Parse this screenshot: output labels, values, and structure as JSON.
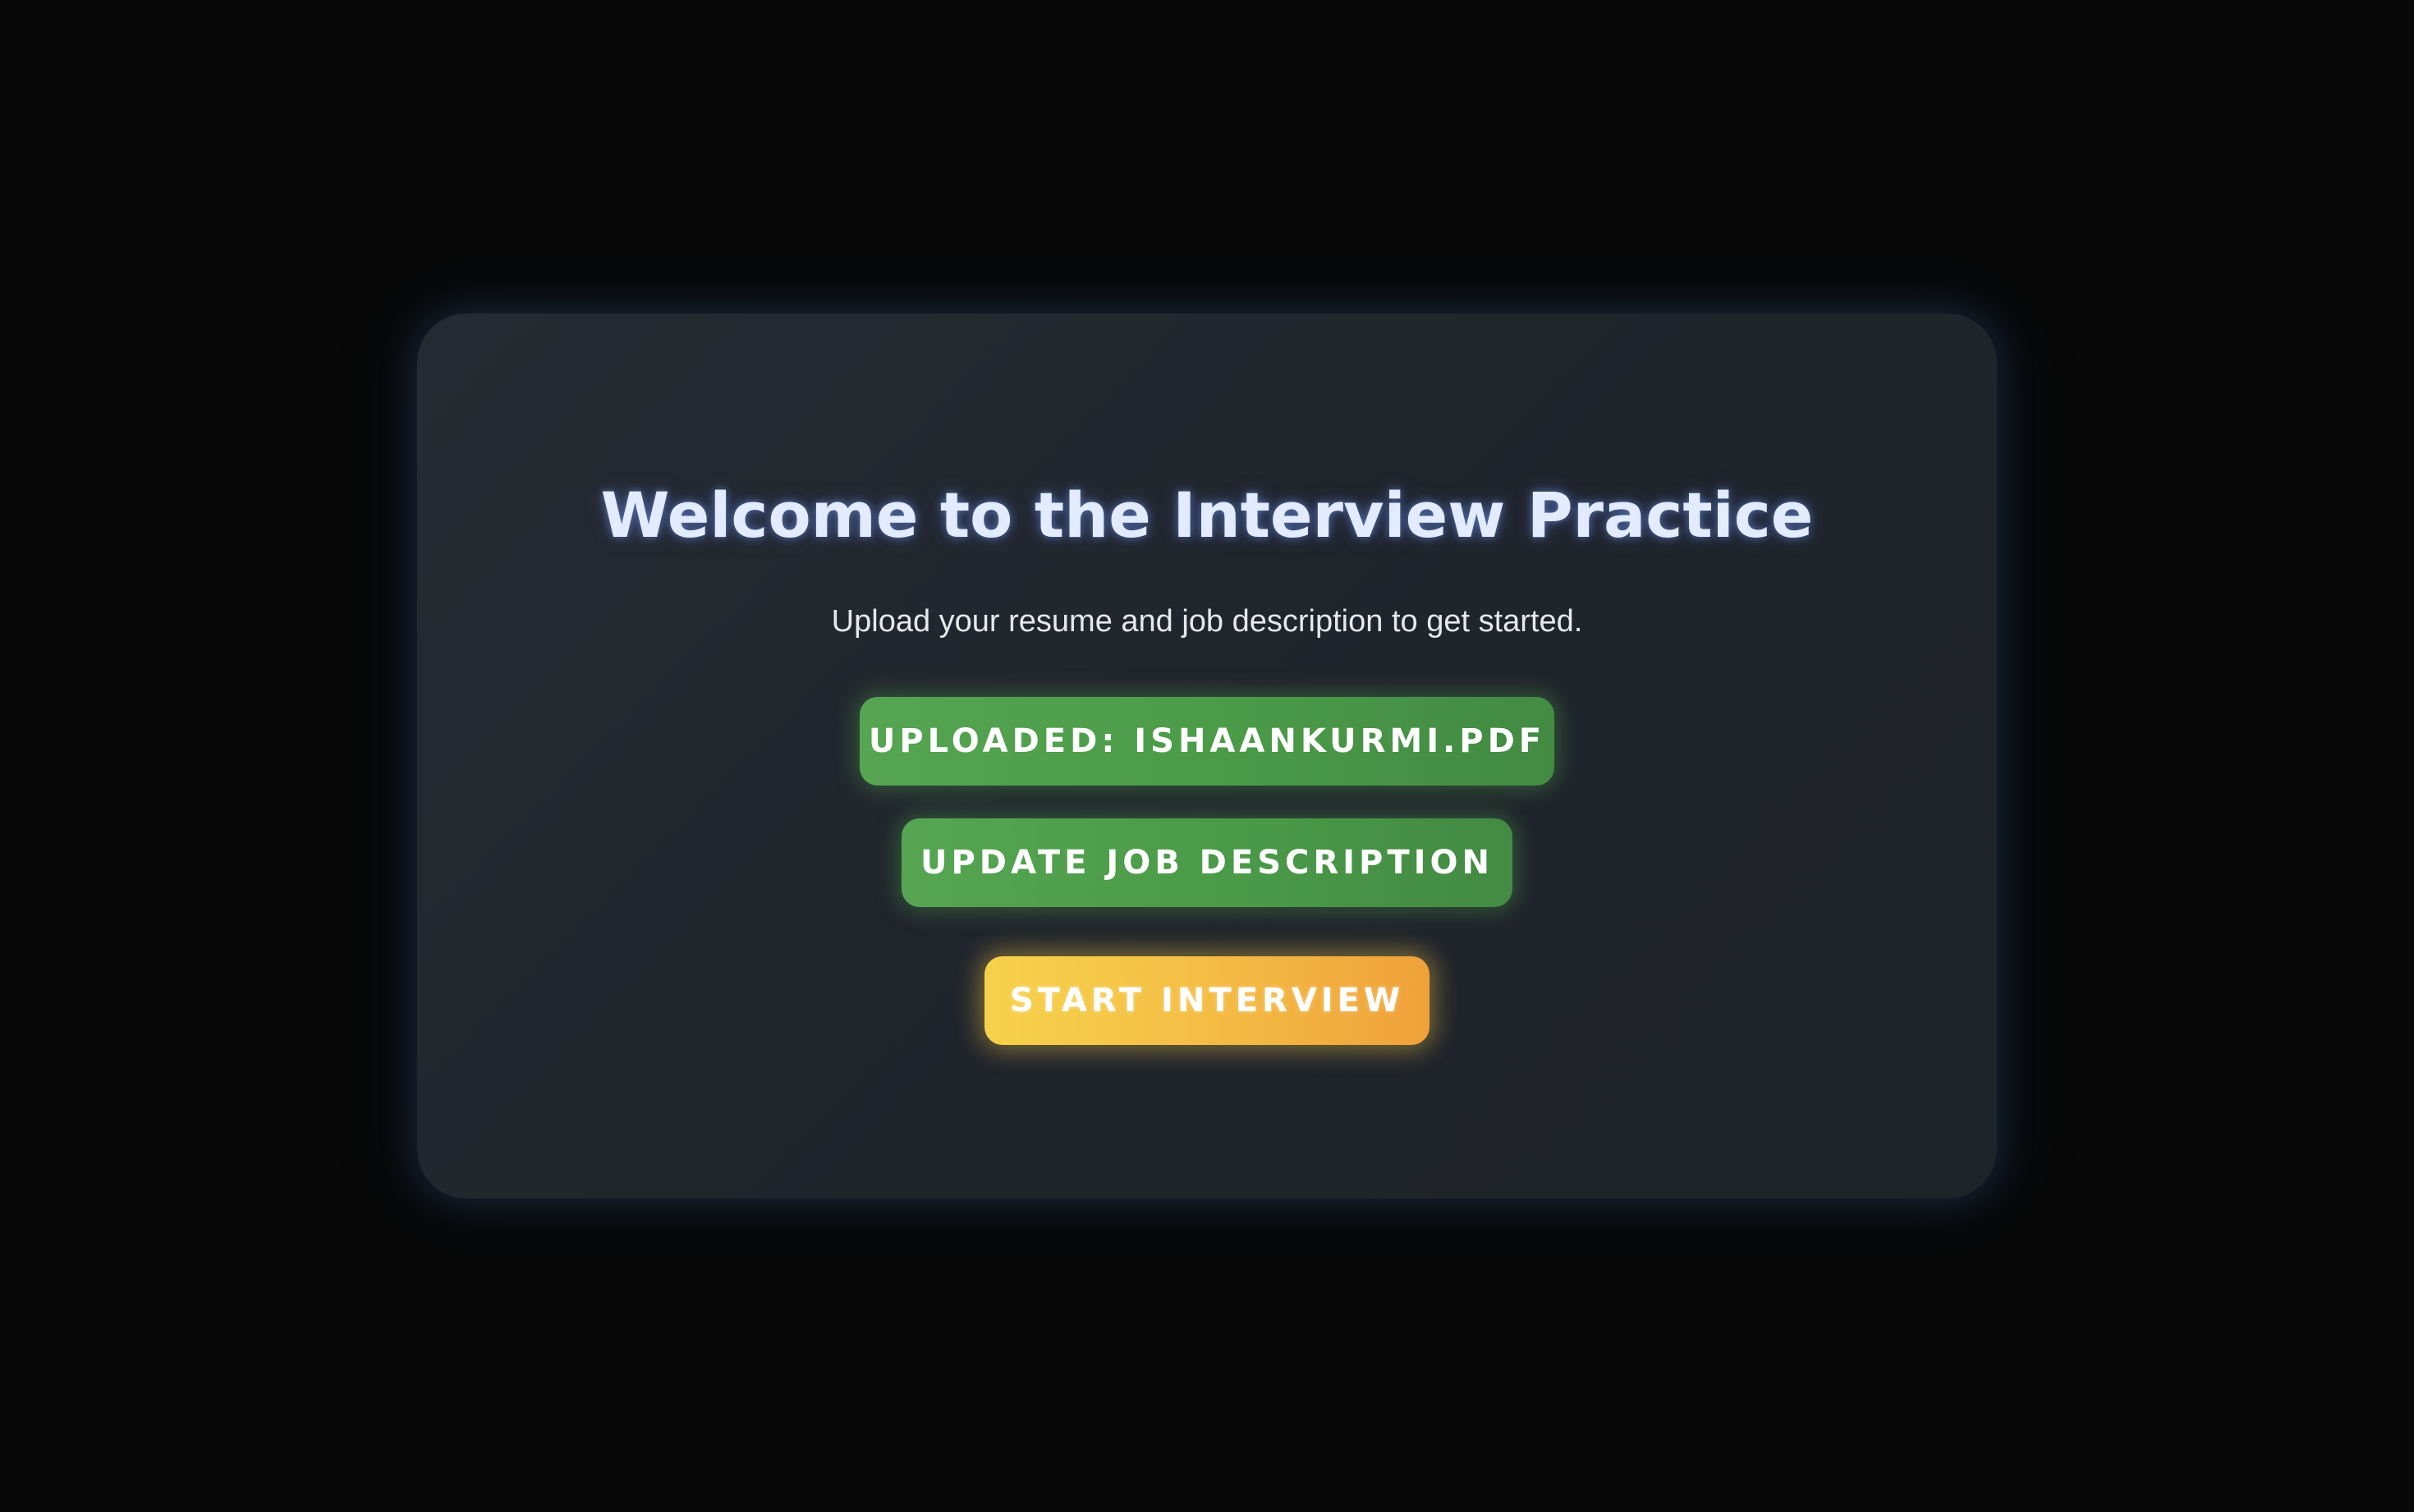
{
  "app": {
    "title": "Welcome to the Interview Practice",
    "subtitle": "Upload your resume and job description to get started."
  },
  "actions": {
    "uploaded_label": "UPLOADED: ISHAANKURMI.PDF",
    "job_description_label": "UPDATE JOB DESCRIPTION",
    "start_label": "START INTERVIEW"
  },
  "colors": {
    "background": "#080808",
    "card": "#22262d",
    "title": "#e2ebff",
    "green_button": "#4e9e4c",
    "start_button_from": "#f6d24c",
    "start_button_to": "#efa13a"
  }
}
